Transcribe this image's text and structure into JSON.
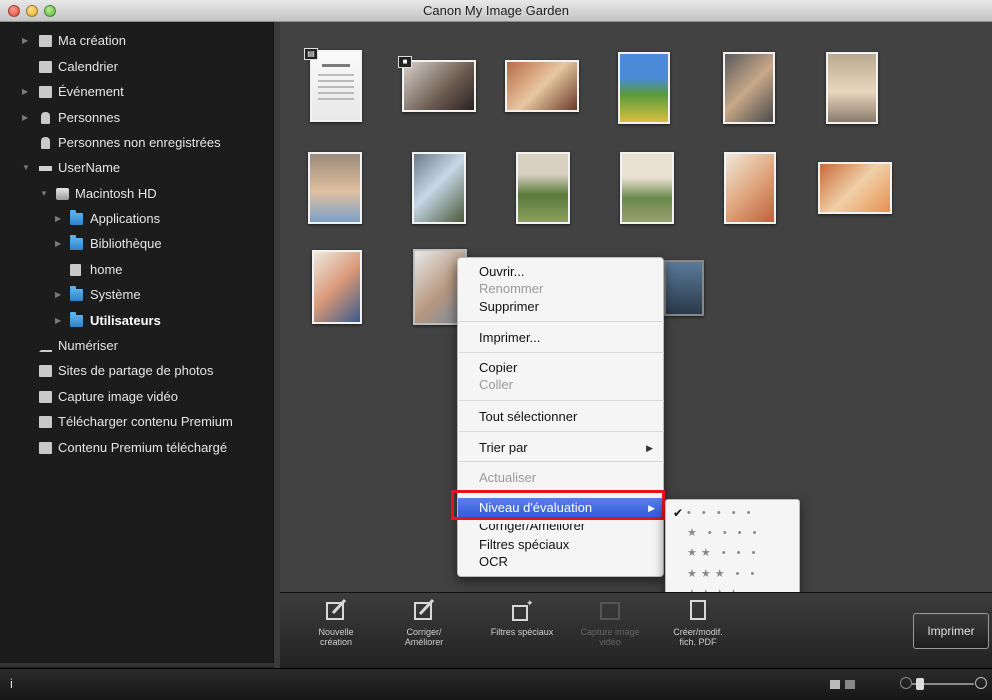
{
  "window": {
    "title": "Canon My Image Garden"
  },
  "sidebar": {
    "items": [
      {
        "label": "Ma création"
      },
      {
        "label": "Calendrier"
      },
      {
        "label": "Événement"
      },
      {
        "label": "Personnes"
      },
      {
        "label": "Personnes non enregistrées"
      },
      {
        "label": "UserName"
      },
      {
        "label": "Macintosh HD"
      },
      {
        "label": "Applications"
      },
      {
        "label": "Bibliothèque"
      },
      {
        "label": "home"
      },
      {
        "label": "Système"
      },
      {
        "label": "Utilisateurs"
      },
      {
        "label": "Numériser"
      },
      {
        "label": "Sites de partage de photos"
      },
      {
        "label": "Capture image vidéo"
      },
      {
        "label": "Télécharger contenu Premium"
      },
      {
        "label": "Contenu Premium téléchargé"
      }
    ]
  },
  "context_menu": {
    "items": [
      {
        "label": "Ouvrir..."
      },
      {
        "label": "Renommer"
      },
      {
        "label": "Supprimer"
      },
      {
        "label": "Imprimer..."
      },
      {
        "label": "Copier"
      },
      {
        "label": "Coller"
      },
      {
        "label": "Tout sélectionner"
      },
      {
        "label": "Trier par"
      },
      {
        "label": "Actualiser"
      },
      {
        "label": "Niveau d'évaluation"
      },
      {
        "label": "Corriger/Améliorer"
      },
      {
        "label": "Filtres spéciaux"
      },
      {
        "label": "OCR"
      }
    ],
    "submenu": {
      "rows": [
        {
          "stars": "• • • • •",
          "check": "✔"
        },
        {
          "stars": "★ • • • •",
          "check": ""
        },
        {
          "stars": "★★ • • •",
          "check": ""
        },
        {
          "stars": "★★★ • •",
          "check": ""
        },
        {
          "stars": "★★★★ •",
          "check": ""
        },
        {
          "stars": "★★★★★",
          "check": ""
        }
      ]
    }
  },
  "toolbar": {
    "buttons": [
      {
        "label": "Nouvelle création",
        "icon": "new-creation-icon"
      },
      {
        "label": "Corriger/ Améliorer",
        "icon": "correct-enhance-icon"
      },
      {
        "label": "Filtres spéciaux",
        "icon": "special-filters-icon"
      },
      {
        "label": "Capture image vidéo",
        "icon": "video-capture-icon"
      },
      {
        "label": "Créer/modif. fich. PDF",
        "icon": "pdf-icon"
      }
    ],
    "print_label": "Imprimer"
  },
  "statusbar": {
    "info": "i"
  },
  "colors": {
    "highlight": "#3060d8",
    "annotation": "#e8141c"
  }
}
